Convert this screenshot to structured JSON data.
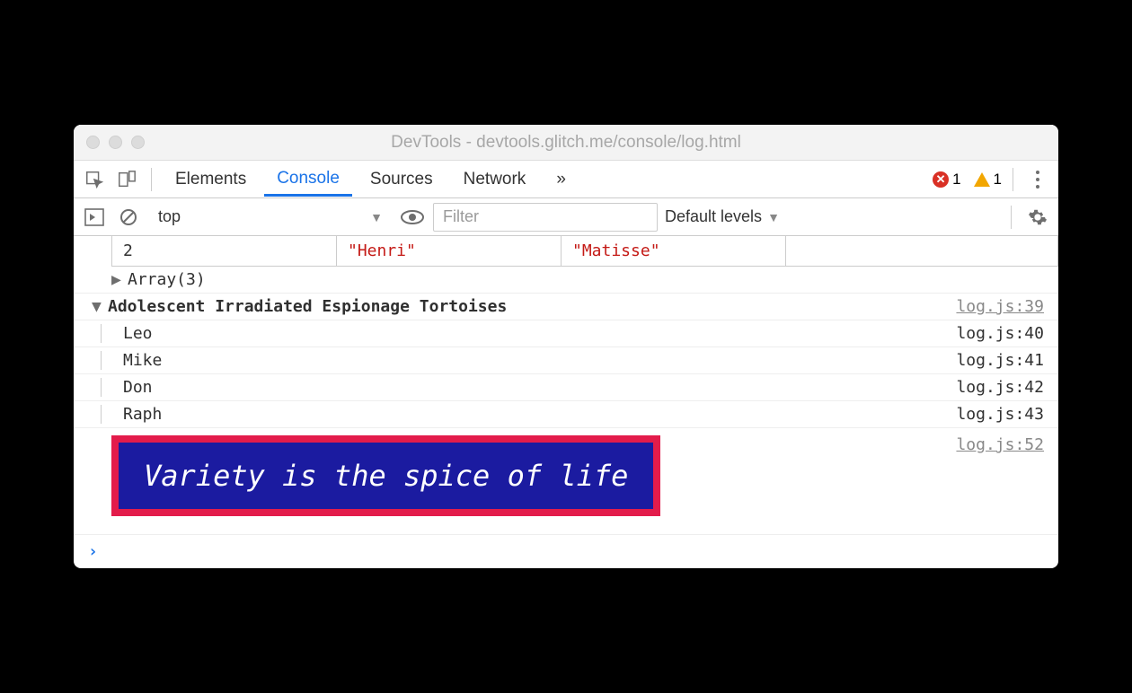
{
  "window": {
    "title": "DevTools - devtools.glitch.me/console/log.html"
  },
  "tabs": {
    "elements": "Elements",
    "console": "Console",
    "sources": "Sources",
    "network": "Network",
    "overflow": "»"
  },
  "counts": {
    "errors": "1",
    "warnings": "1"
  },
  "toolbar": {
    "context": "top",
    "filter_placeholder": "Filter",
    "levels": "Default levels"
  },
  "table": {
    "index": "2",
    "cells": [
      "\"Henri\"",
      "\"Matisse\""
    ]
  },
  "array_preview": "Array(3)",
  "group": {
    "title": "Adolescent Irradiated Espionage Tortoises",
    "source": "log.js:39",
    "items": [
      {
        "text": "Leo",
        "source": "log.js:40"
      },
      {
        "text": "Mike",
        "source": "log.js:41"
      },
      {
        "text": "Don",
        "source": "log.js:42"
      },
      {
        "text": "Raph",
        "source": "log.js:43"
      }
    ]
  },
  "styled": {
    "text": "Variety is the spice of life",
    "source": "log.js:52"
  },
  "prompt": "›"
}
